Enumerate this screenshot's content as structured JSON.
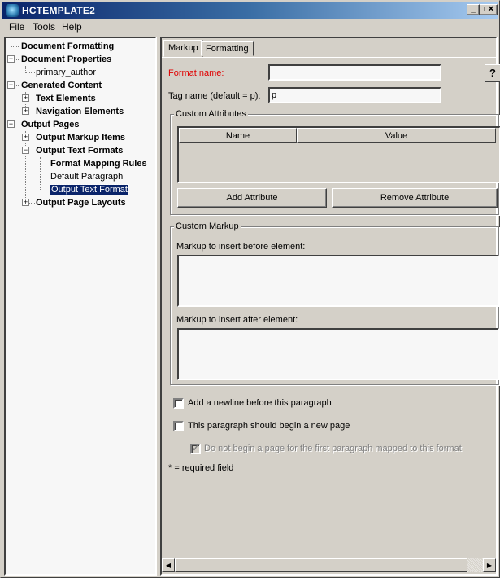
{
  "window": {
    "title": "HCTEMPLATE2",
    "minimize_glyph": "_",
    "maximize_glyph": "□",
    "close_glyph": "✕"
  },
  "menu": [
    "File",
    "Tools",
    "Help"
  ],
  "tree": {
    "expand_glyph": "+",
    "collapse_glyph": "−",
    "items": [
      {
        "label": "Document Formatting",
        "level": 0,
        "bold": true,
        "toggle": null
      },
      {
        "label": "Document Properties",
        "level": 0,
        "bold": true,
        "toggle": "expanded"
      },
      {
        "label": "primary_author",
        "level": 1,
        "bold": false,
        "toggle": null
      },
      {
        "label": "Generated Content",
        "level": 0,
        "bold": true,
        "toggle": "expanded"
      },
      {
        "label": "Text Elements",
        "level": 1,
        "bold": true,
        "toggle": "collapsed"
      },
      {
        "label": "Navigation Elements",
        "level": 1,
        "bold": true,
        "toggle": "collapsed"
      },
      {
        "label": "Output Pages",
        "level": 0,
        "bold": true,
        "toggle": "expanded"
      },
      {
        "label": "Output Markup Items",
        "level": 1,
        "bold": true,
        "toggle": "collapsed"
      },
      {
        "label": "Output Text Formats",
        "level": 1,
        "bold": true,
        "toggle": "expanded"
      },
      {
        "label": "Format Mapping Rules",
        "level": 2,
        "bold": true,
        "toggle": null
      },
      {
        "label": "Default Paragraph",
        "level": 2,
        "bold": false,
        "toggle": null
      },
      {
        "label": "Output Text Format",
        "level": 2,
        "bold": false,
        "toggle": null,
        "selected": true
      },
      {
        "label": "Output Page Layouts",
        "level": 1,
        "bold": true,
        "toggle": "collapsed"
      }
    ]
  },
  "tabs": [
    {
      "label": "Markup",
      "active": true
    },
    {
      "label": "Formatting",
      "active": false
    }
  ],
  "form": {
    "help_glyph": "?",
    "format_name_label": "Format name:",
    "format_name_value": "",
    "tag_name_label": "Tag name (default = p):",
    "tag_name_value": "p",
    "custom_attributes": {
      "legend": "Custom Attributes",
      "columns": [
        "Name",
        "Value"
      ],
      "rows": [],
      "add_button": "Add Attribute",
      "remove_button": "Remove Attribute"
    },
    "custom_markup": {
      "legend": "Custom Markup",
      "before_label": "Markup to insert before element:",
      "before_value": "",
      "after_label": "Markup to insert after element:",
      "after_value": ""
    },
    "checkboxes": [
      {
        "label": "Add a newline before this paragraph",
        "checked": false,
        "enabled": true
      },
      {
        "label": "This paragraph should begin a new page",
        "checked": false,
        "enabled": true
      },
      {
        "label": "Do not begin a page for the first paragraph mapped to this format",
        "checked": true,
        "enabled": false
      }
    ],
    "required_note": "* = required field"
  },
  "colors": {
    "required_label": "#e00000",
    "selection": "#0a246a",
    "face": "#d4d0c8"
  }
}
